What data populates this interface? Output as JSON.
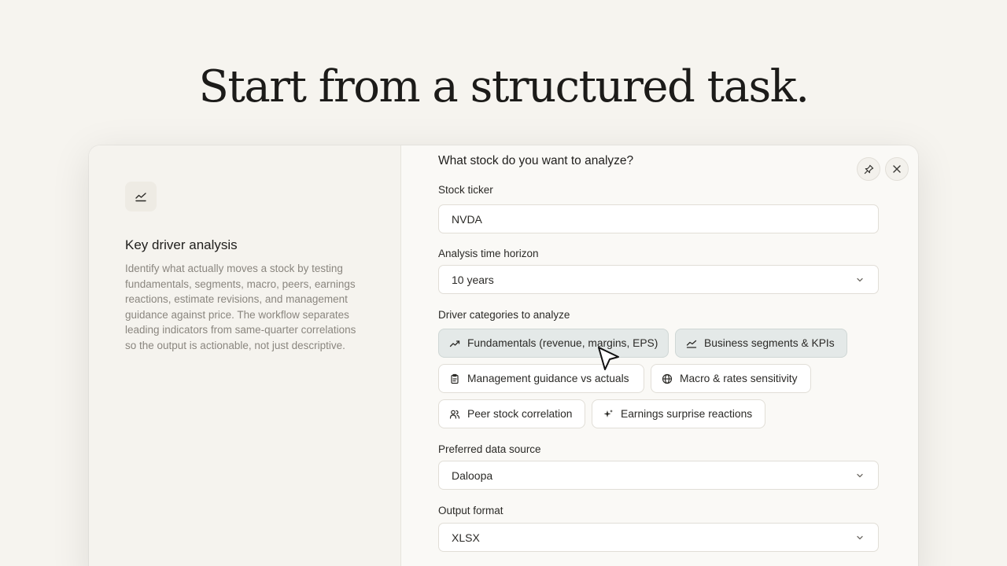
{
  "headline": "Start from a structured task.",
  "task": {
    "icon": "trend-chart-icon",
    "title": "Key driver analysis",
    "description": "Identify what actually moves a stock by testing fundamentals, segments, macro, peers, earnings reactions, estimate revisions, and management guidance against price. The workflow separates leading indicators from same-quarter correlations so the output is actionable, not just descriptive."
  },
  "form": {
    "question": "What stock do you want to analyze?",
    "ticker": {
      "label": "Stock ticker",
      "value": "NVDA"
    },
    "horizon": {
      "label": "Analysis time horizon",
      "value": "10 years"
    },
    "drivers": {
      "label": "Driver categories to analyze",
      "options": [
        {
          "label": "Fundamentals (revenue, margins, EPS)",
          "icon": "trend-up-icon",
          "selected": true
        },
        {
          "label": "Business segments & KPIs",
          "icon": "area-chart-icon",
          "selected": true
        },
        {
          "label": "Management guidance vs actuals",
          "icon": "clipboard-icon",
          "selected": false
        },
        {
          "label": "Macro & rates sensitivity",
          "icon": "globe-icon",
          "selected": false
        },
        {
          "label": "Peer stock correlation",
          "icon": "users-icon",
          "selected": false
        },
        {
          "label": "Earnings surprise reactions",
          "icon": "sparkles-icon",
          "selected": false
        }
      ]
    },
    "source": {
      "label": "Preferred data source",
      "value": "Daloopa"
    },
    "output": {
      "label": "Output format",
      "value": "XLSX"
    }
  },
  "colors": {
    "background": "#f6f4ef",
    "selected_chip": "#e4e9e8",
    "muted_text": "#8a867f"
  }
}
